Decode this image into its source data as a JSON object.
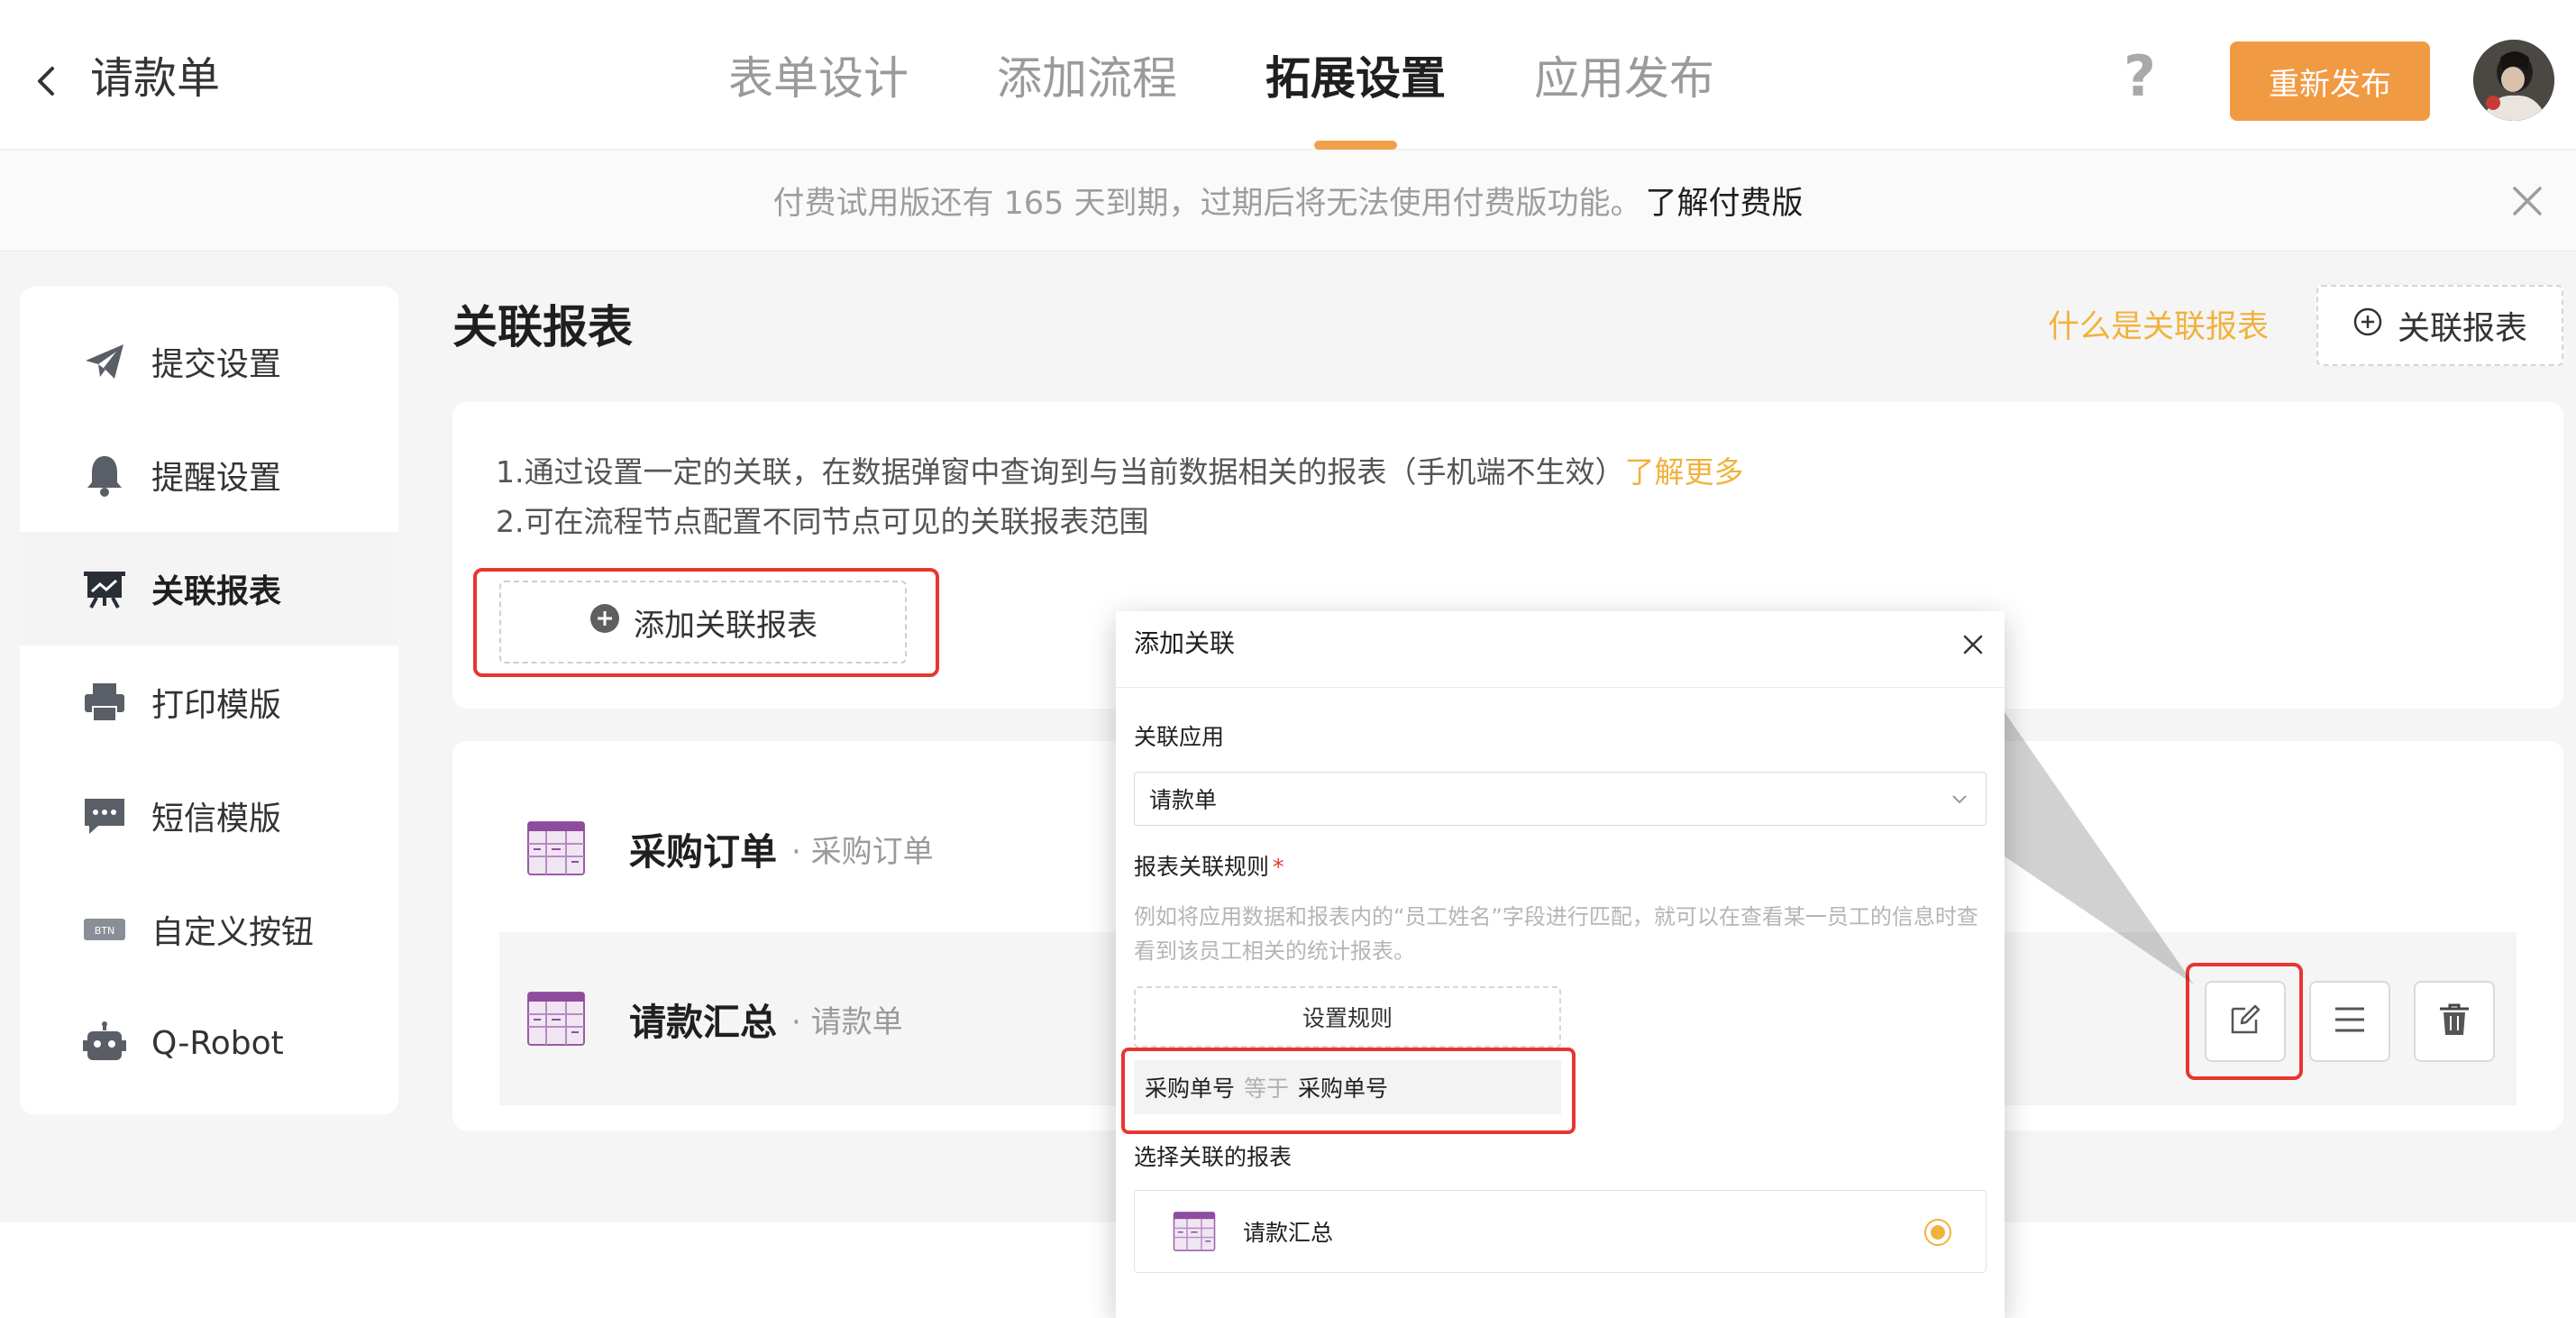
{
  "header": {
    "title": "请款单",
    "tabs": [
      {
        "label": "表单设计",
        "active": false
      },
      {
        "label": "添加流程",
        "active": false
      },
      {
        "label": "拓展设置",
        "active": true
      },
      {
        "label": "应用发布",
        "active": false
      }
    ],
    "help_label": "?",
    "publish_label": "重新发布",
    "accent_color": "#f19a44"
  },
  "banner": {
    "text": "付费试用版还有 165 天到期，过期后将无法使用付费版功能。",
    "link": "了解付费版"
  },
  "sidebar": {
    "items": [
      {
        "label": "提交设置",
        "icon": "send-icon",
        "active": false
      },
      {
        "label": "提醒设置",
        "icon": "bell-icon",
        "active": false
      },
      {
        "label": "关联报表",
        "icon": "report-board-icon",
        "active": true
      },
      {
        "label": "打印模版",
        "icon": "printer-icon",
        "active": false
      },
      {
        "label": "短信模版",
        "icon": "message-icon",
        "active": false
      },
      {
        "label": "自定义按钮",
        "icon": "btn-icon",
        "active": false
      },
      {
        "label": "Q-Robot",
        "icon": "robot-icon",
        "active": false
      }
    ],
    "btn_icon_text": "BTN"
  },
  "main": {
    "title": "关联报表",
    "what_link": "什么是关联报表",
    "add_button": "关联报表",
    "desc_line1": "1.通过设置一定的关联，在数据弹窗中查询到与当前数据相关的报表（手机端不生效）",
    "learn_more": "了解更多",
    "desc_line2": "2.可在流程节点配置不同节点可见的关联报表范围",
    "add_related": "添加关联报表",
    "reports": [
      {
        "name": "采购订单",
        "source": "· 采购订单"
      },
      {
        "name": "请款汇总",
        "source": "· 请款单"
      }
    ]
  },
  "dialog": {
    "title": "添加关联",
    "app_label": "关联应用",
    "app_value": "请款单",
    "rule_label": "报表关联规则",
    "required_mark": "*",
    "hint": "例如将应用数据和报表内的“员工姓名”字段进行匹配，就可以在查看某一员工的信息时查看到该员工相关的统计报表。",
    "set_rule": "设置规则",
    "rule": {
      "left": "采购单号",
      "op": "等于",
      "right": "采购单号"
    },
    "select_label": "选择关联的报表",
    "selected_report": "请款汇总",
    "highlight_color": "#e8362f",
    "link_color": "#f1b23c"
  }
}
